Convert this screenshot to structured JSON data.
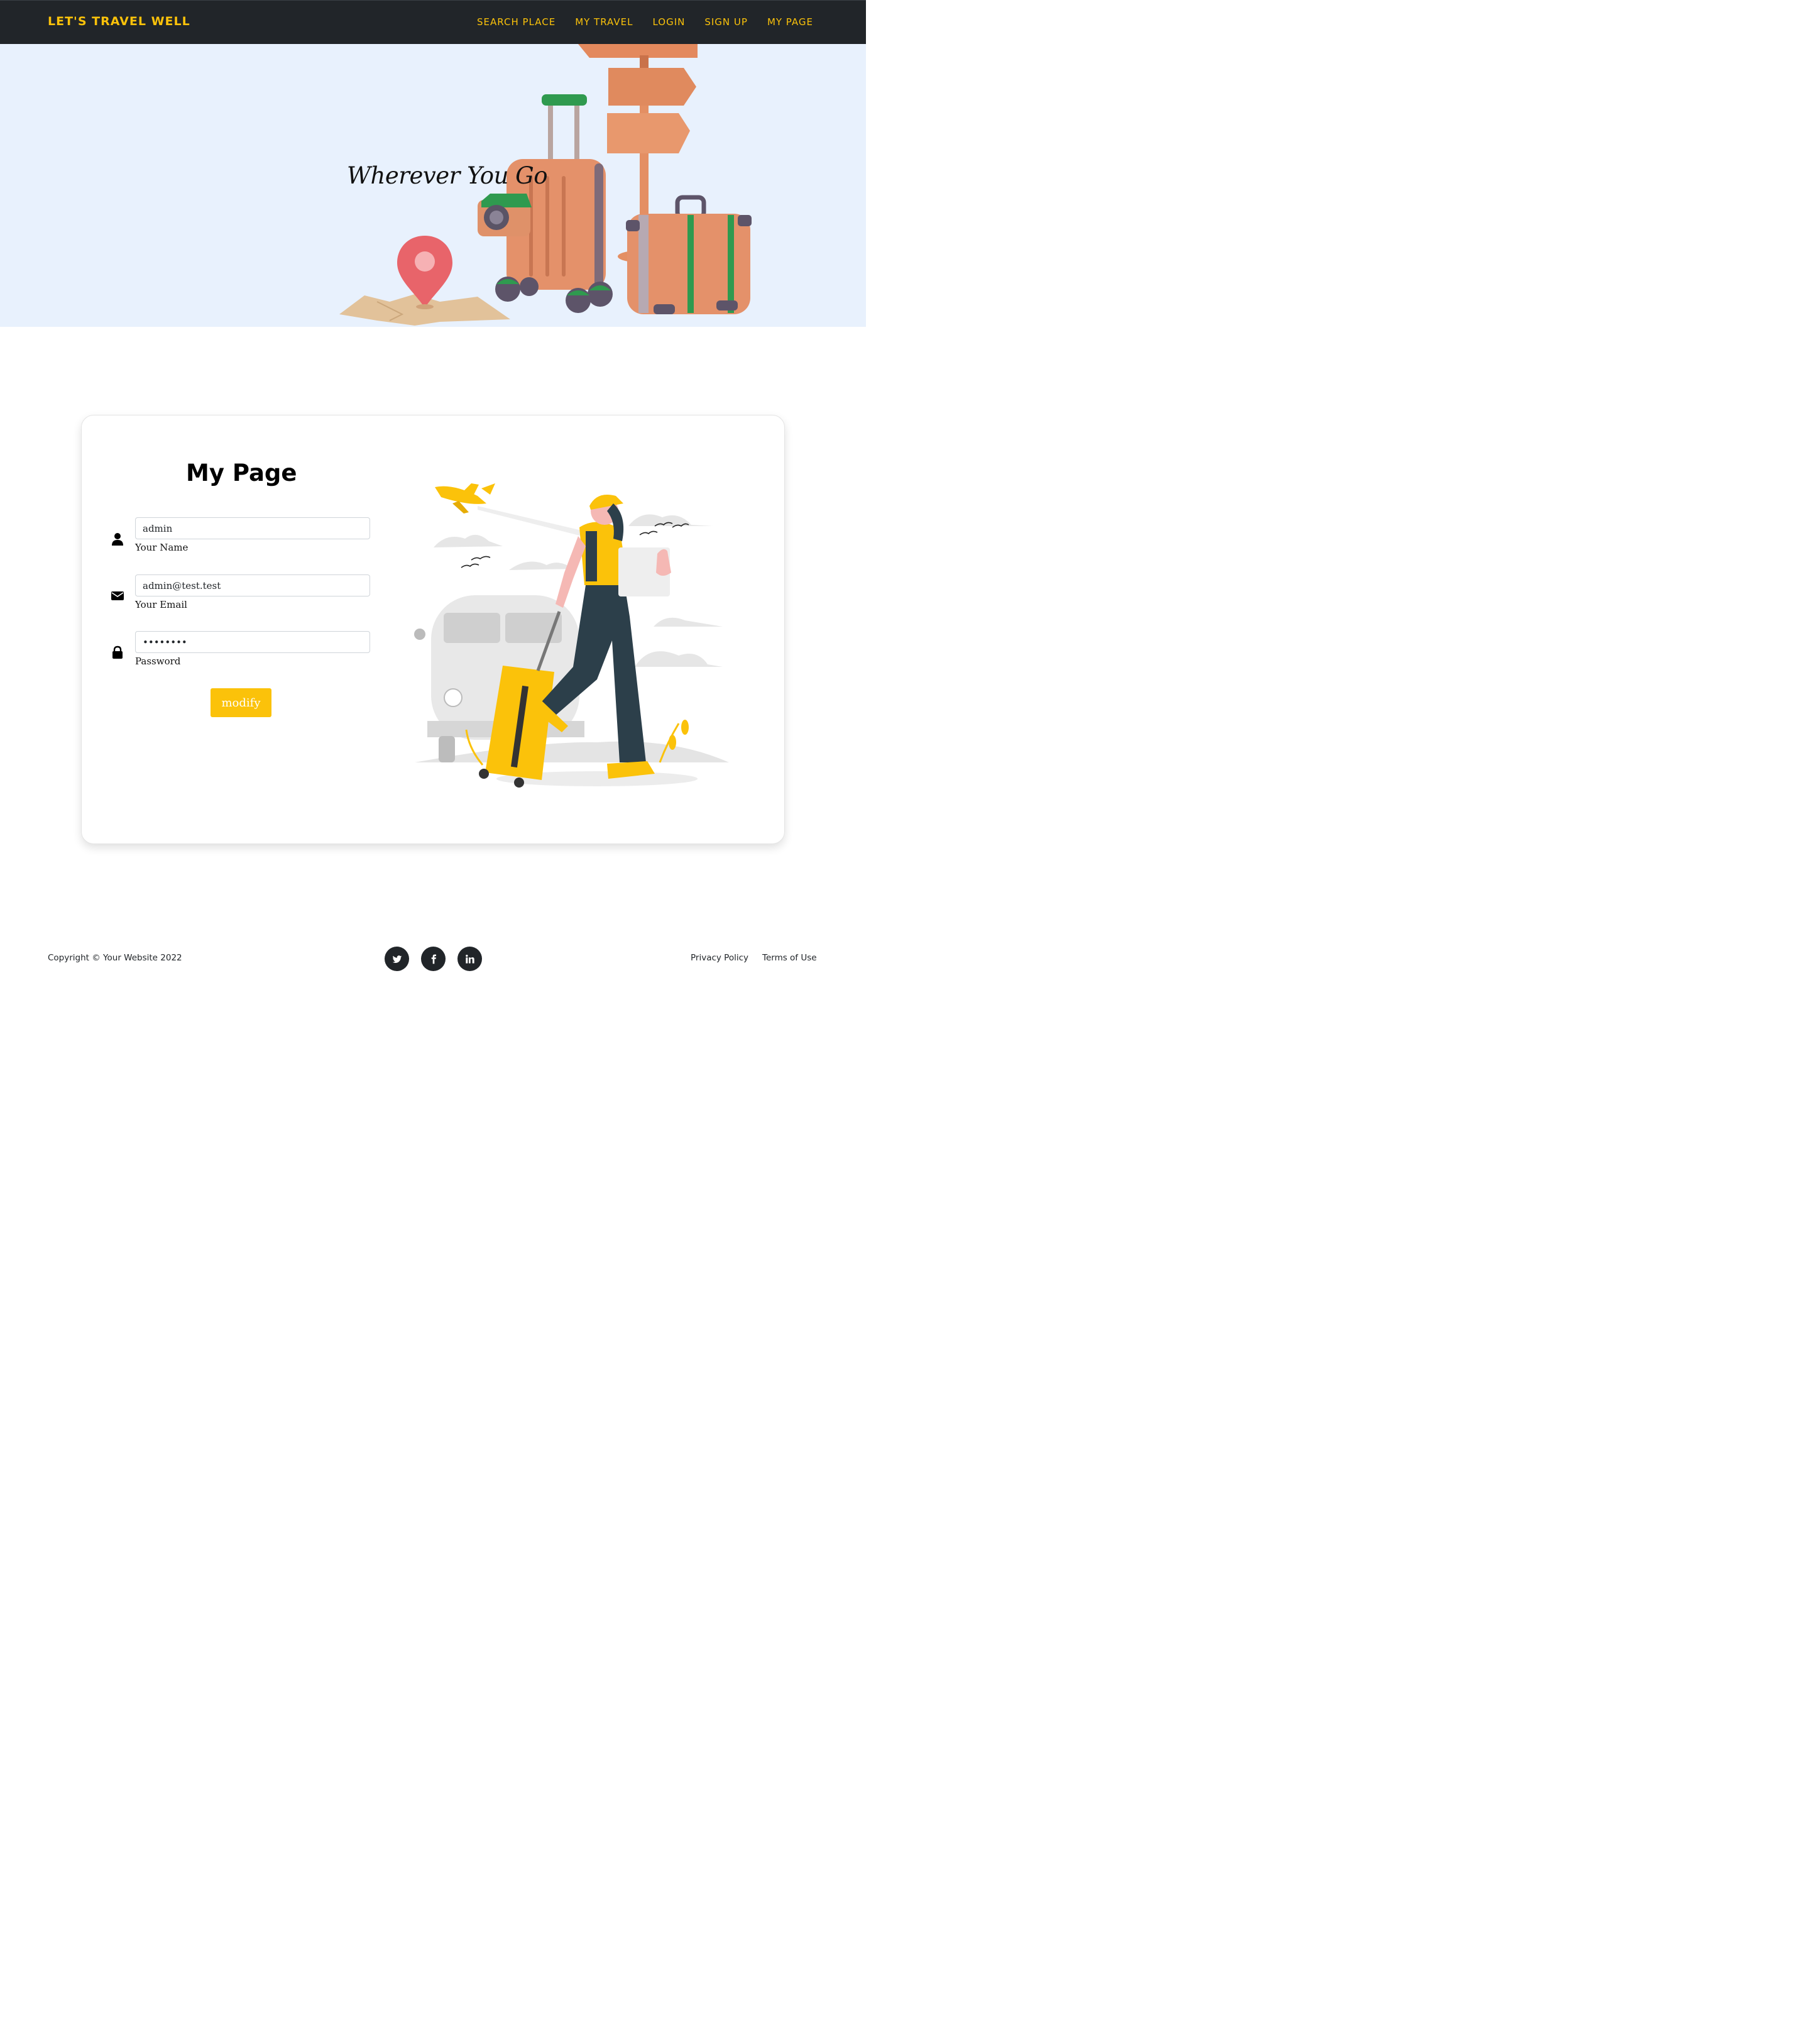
{
  "navbar": {
    "brand": "LET'S TRAVEL WELL",
    "links": [
      "SEARCH PLACE",
      "MY TRAVEL",
      "LOGIN",
      "SIGN UP",
      "MY PAGE"
    ]
  },
  "hero": {
    "title": "Wherever You Go"
  },
  "mypage": {
    "title": "My Page",
    "fields": {
      "name": {
        "value": "admin",
        "label": "Your Name",
        "icon": "user-icon"
      },
      "email": {
        "value": "admin@test.test",
        "label": "Your Email",
        "icon": "envelope-icon"
      },
      "password": {
        "value": "••••••••",
        "label": "Password",
        "icon": "lock-icon"
      }
    },
    "button": "modify"
  },
  "footer": {
    "copyright": "Copyright © Your Website 2022",
    "social": [
      "twitter-icon",
      "facebook-icon",
      "linkedin-icon"
    ],
    "links": [
      "Privacy Policy",
      "Terms of Use"
    ]
  },
  "colors": {
    "accent": "#fbc20a",
    "navbar_bg": "#212529",
    "hero_bg": "#e8f1fd"
  }
}
